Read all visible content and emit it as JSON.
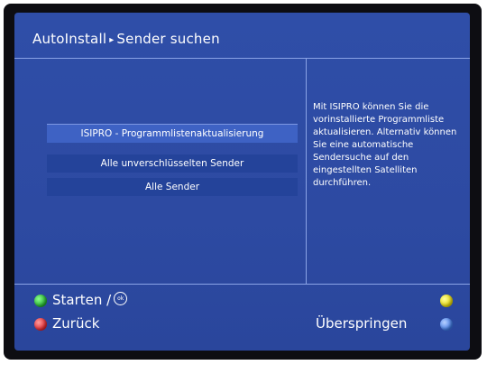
{
  "header": {
    "crumb1": "AutoInstall",
    "separator": "▸",
    "crumb2": "Sender suchen"
  },
  "options": [
    {
      "label": "ISIPRO - Programmlistenaktualisierung",
      "selected": true
    },
    {
      "label": "Alle unverschlüsselten Sender",
      "selected": false
    },
    {
      "label": "Alle Sender",
      "selected": false
    }
  ],
  "help_text": "Mit ISIPRO können Sie die vorinstallierte Programmliste aktualisieren. Alternativ können Sie eine automatische Sendersuche auf den eingestellten Satelliten durchführen.",
  "footer": {
    "start_label": "Starten /",
    "ok_glyph": "ok",
    "back_label": "Zurück",
    "skip_label": "Überspringen"
  },
  "colors": {
    "background": "#2d4aa2",
    "selection": "#3e62c4",
    "option": "#24439a",
    "green_key": "#1fae2a",
    "red_key": "#e0222b",
    "yellow_key": "#e3d400",
    "blue_key": "#3c78e6"
  }
}
